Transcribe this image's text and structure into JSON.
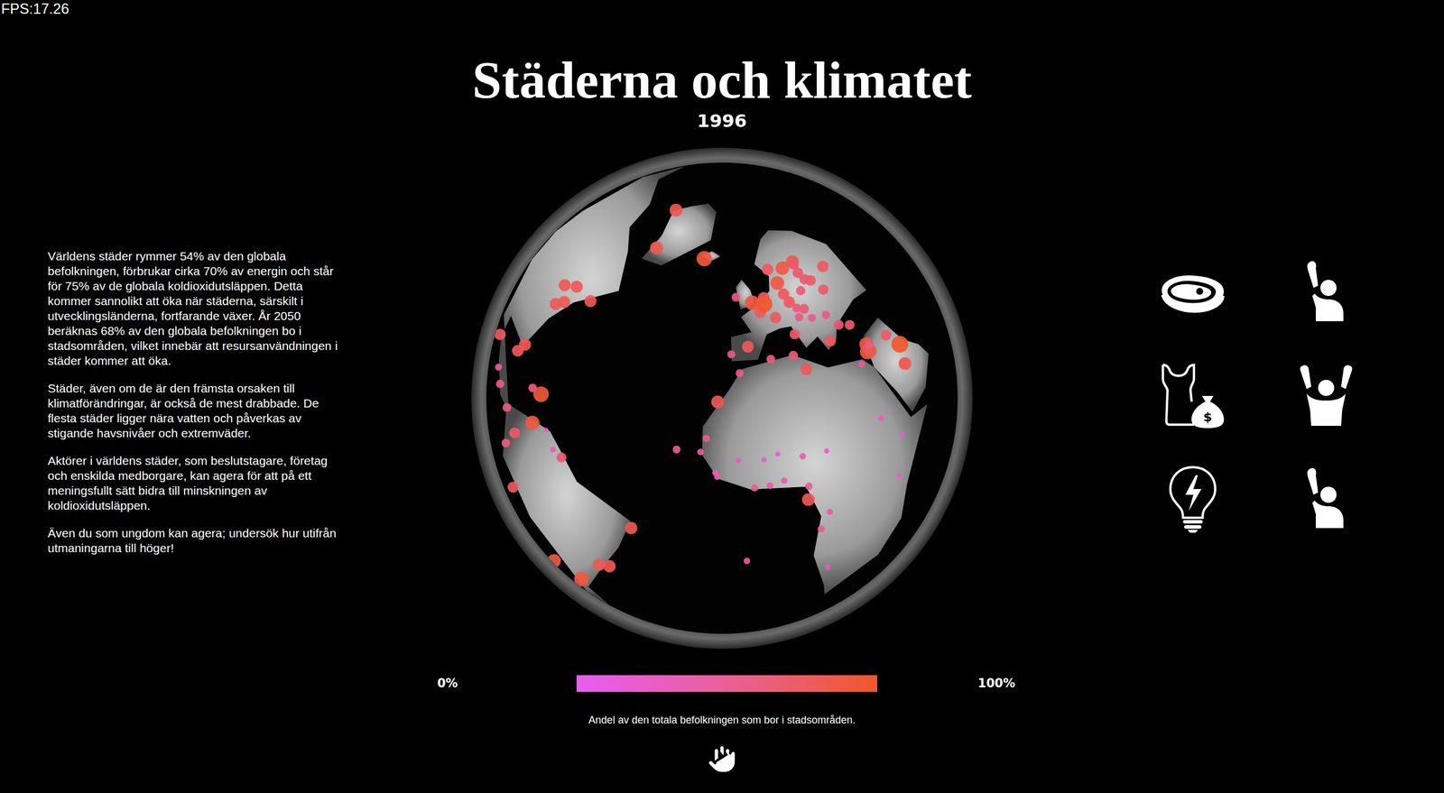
{
  "fps": "FPS:17.26",
  "title": "Städerna och klimatet",
  "year": "1996",
  "intro": [
    "Världens städer rymmer 54% av den globala befolkningen, förbrukar cirka 70% av energin och står för 75% av de globala koldioxidutsläppen. Detta kommer sannolikt att öka när städerna, särskilt i utvecklingsländerna, fortfarande växer. År 2050 beräknas 68% av den globala befolkningen bo i stadsområden, vilket innebär att resursanvändningen i städer kommer att öka.",
    "Städer, även om de är den främsta orsaken till klimatförändringar, är också de mest drabbade. De flesta städer ligger nära vatten och påverkas av stigande havsnivåer och extremväder.",
    "Aktörer i världens städer, som beslutstagare, företag och enskilda medborgare, kan agera för att på ett meningsfullt sätt bidra till minskningen av koldioxidutsläppen.",
    "Även du som ungdom kan agera; undersök hur utifrån utmaningarna till höger!"
  ],
  "legend": {
    "min": "0%",
    "max": "100%",
    "caption": "Andel av den totala befolkningen som bor i stadsområden."
  },
  "cities": [
    {
      "lon": -0.1,
      "lat": 51.5,
      "level": 0.89
    },
    {
      "lon": 2.3,
      "lat": 48.9,
      "level": 0.76
    },
    {
      "lon": -3.7,
      "lat": 40.4,
      "level": 0.76
    },
    {
      "lon": -9.1,
      "lat": 38.7,
      "level": 0.52
    },
    {
      "lon": 12.5,
      "lat": 41.9,
      "level": 0.67
    },
    {
      "lon": 13.4,
      "lat": 52.5,
      "level": 0.73
    },
    {
      "lon": 4.9,
      "lat": 52.4,
      "level": 0.75
    },
    {
      "lon": 4.4,
      "lat": 50.8,
      "level": 0.97
    },
    {
      "lon": 18.1,
      "lat": 59.3,
      "level": 0.84
    },
    {
      "lon": 10.7,
      "lat": 59.9,
      "level": 0.74
    },
    {
      "lon": 24.9,
      "lat": 60.2,
      "level": 0.81
    },
    {
      "lon": 12.6,
      "lat": 55.7,
      "level": 0.85
    },
    {
      "lon": 21.0,
      "lat": 52.2,
      "level": 0.61
    },
    {
      "lon": 16.4,
      "lat": 48.2,
      "level": 0.58
    },
    {
      "lon": 14.4,
      "lat": 50.1,
      "level": 0.74
    },
    {
      "lon": 19.0,
      "lat": 47.5,
      "level": 0.64
    },
    {
      "lon": 26.1,
      "lat": 44.4,
      "level": 0.54
    },
    {
      "lon": 23.7,
      "lat": 38.0,
      "level": 0.72
    },
    {
      "lon": 29.0,
      "lat": 41.0,
      "level": 0.65
    },
    {
      "lon": -6.3,
      "lat": 53.3,
      "level": 0.58
    },
    {
      "lon": -21.9,
      "lat": 64.1,
      "level": 0.92
    },
    {
      "lon": 37.6,
      "lat": 55.8,
      "level": 0.73
    },
    {
      "lon": 30.5,
      "lat": 50.5,
      "level": 0.67
    },
    {
      "lon": 27.6,
      "lat": 53.9,
      "level": 0.69
    },
    {
      "lon": 20.5,
      "lat": 44.8,
      "level": 0.52
    },
    {
      "lon": 16.0,
      "lat": 45.8,
      "level": 0.55
    },
    {
      "lon": 7.4,
      "lat": 46.9,
      "level": 0.73
    },
    {
      "lon": 24.1,
      "lat": 56.9,
      "level": 0.68
    },
    {
      "lon": 25.3,
      "lat": 54.7,
      "level": 0.67
    },
    {
      "lon": 24.7,
      "lat": 59.4,
      "level": 0.69
    },
    {
      "lon": 31.2,
      "lat": 30.0,
      "level": 0.43
    },
    {
      "lon": 34.8,
      "lat": 32.1,
      "level": 0.91
    },
    {
      "lon": 35.5,
      "lat": 33.9,
      "level": 0.85
    },
    {
      "lon": 35.9,
      "lat": 32.0,
      "level": 0.8
    },
    {
      "lon": 46.7,
      "lat": 24.7,
      "level": 0.8
    },
    {
      "lon": 44.4,
      "lat": 33.3,
      "level": 0.69
    },
    {
      "lon": 36.3,
      "lat": 33.5,
      "level": 0.52
    },
    {
      "lon": 32.9,
      "lat": 39.9,
      "level": 0.64
    },
    {
      "lon": 48.0,
      "lat": 29.4,
      "level": 0.98
    },
    {
      "lon": 3.0,
      "lat": 36.8,
      "level": 0.57
    },
    {
      "lon": 10.2,
      "lat": 36.8,
      "level": 0.62
    },
    {
      "lon": -6.8,
      "lat": 34.0,
      "level": 0.52
    },
    {
      "lon": 13.2,
      "lat": 32.9,
      "level": 0.76
    },
    {
      "lon": -17.4,
      "lat": 14.7,
      "level": 0.4
    },
    {
      "lon": -8.0,
      "lat": 12.6,
      "level": 0.27
    },
    {
      "lon": 2.1,
      "lat": 13.5,
      "level": 0.16
    },
    {
      "lon": 3.4,
      "lat": 6.5,
      "level": 0.37
    },
    {
      "lon": -0.2,
      "lat": 5.6,
      "level": 0.4
    },
    {
      "lon": -4.0,
      "lat": 5.3,
      "level": 0.43
    },
    {
      "lon": 15.3,
      "lat": -4.3,
      "level": 0.37
    },
    {
      "lon": 13.2,
      "lat": -8.8,
      "level": 0.44
    },
    {
      "lon": 36.8,
      "lat": -1.3,
      "level": 0.2
    },
    {
      "lon": 38.7,
      "lat": 9.0,
      "level": 0.15
    },
    {
      "lon": 32.5,
      "lat": 15.6,
      "level": 0.31
    },
    {
      "lon": 15.0,
      "lat": 12.1,
      "level": 0.21
    },
    {
      "lon": 9.7,
      "lat": 4.0,
      "level": 0.46
    },
    {
      "lon": -13.2,
      "lat": 8.5,
      "level": 0.35
    },
    {
      "lon": -13.7,
      "lat": 9.5,
      "level": 0.3
    },
    {
      "lon": -1.5,
      "lat": 12.4,
      "level": 0.18
    },
    {
      "lon": 8.5,
      "lat": 12.0,
      "level": 0.37
    },
    {
      "lon": 17.1,
      "lat": -22.6,
      "level": 0.29
    },
    {
      "lon": -16.0,
      "lat": 18.1,
      "level": 0.46
    },
    {
      "lon": -13.2,
      "lat": 27.1,
      "level": 0.8
    },
    {
      "lon": -23.5,
      "lat": 14.9,
      "level": 0.5
    },
    {
      "lon": -5.7,
      "lat": -15.9,
      "level": 0.39
    },
    {
      "lon": 9.5,
      "lat": 0.4,
      "level": 0.8
    },
    {
      "lon": -66.9,
      "lat": 10.5,
      "level": 0.87
    },
    {
      "lon": -74.0,
      "lat": 4.7,
      "level": 0.7
    },
    {
      "lon": -77.0,
      "lat": -12.0,
      "level": 0.71
    },
    {
      "lon": -78.5,
      "lat": -0.2,
      "level": 0.57
    },
    {
      "lon": -70.6,
      "lat": -33.4,
      "level": 0.84
    },
    {
      "lon": -58.4,
      "lat": -34.6,
      "level": 0.89
    },
    {
      "lon": -46.6,
      "lat": -23.5,
      "level": 0.78
    },
    {
      "lon": -43.2,
      "lat": -22.9,
      "level": 0.78
    },
    {
      "lon": -34.9,
      "lat": -8.0,
      "level": 0.78
    },
    {
      "lon": -82.4,
      "lat": 23.1,
      "level": 0.75
    },
    {
      "lon": -99.1,
      "lat": 19.4,
      "level": 0.74
    },
    {
      "lon": -74.0,
      "lat": 40.7,
      "level": 0.77
    },
    {
      "lon": -77.0,
      "lat": 38.9,
      "level": 0.77
    },
    {
      "lon": -79.4,
      "lat": 43.7,
      "level": 0.77
    },
    {
      "lon": -73.6,
      "lat": 45.5,
      "level": 0.77
    },
    {
      "lon": -63.6,
      "lat": 44.6,
      "level": 0.77
    },
    {
      "lon": -80.2,
      "lat": 25.8,
      "level": 0.77
    },
    {
      "lon": -51.7,
      "lat": 64.2,
      "level": 0.81
    },
    {
      "lon": -69.9,
      "lat": 18.5,
      "level": 0.56
    },
    {
      "lon": -66.0,
      "lat": 18.4,
      "level": 0.93
    },
    {
      "lon": -79.5,
      "lat": 9.0,
      "level": 0.57
    },
    {
      "lon": -90.5,
      "lat": 14.6,
      "level": 0.43
    },
    {
      "lon": -86.3,
      "lat": 12.1,
      "level": 0.54
    },
    {
      "lon": -61.5,
      "lat": 10.7,
      "level": 0.1
    },
    {
      "lon": -58.2,
      "lat": 6.8,
      "level": 0.29
    },
    {
      "lon": -55.2,
      "lat": 5.8,
      "level": 0.65
    },
    {
      "lon": -68.7,
      "lat": 76.5,
      "level": 0.81
    }
  ]
}
